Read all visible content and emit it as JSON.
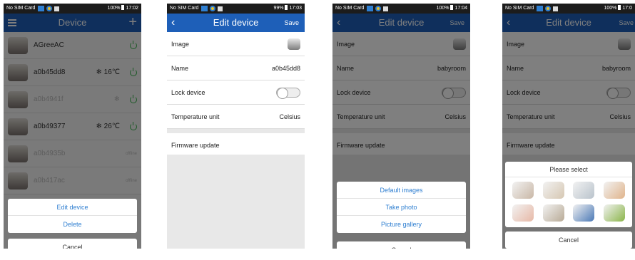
{
  "status_bars": [
    {
      "carrier": "No SIM Card",
      "right": "100%",
      "time": "17:02"
    },
    {
      "carrier": "No SIM Card",
      "right": "99%",
      "time": "17:03"
    },
    {
      "carrier": "No SIM Card",
      "right": "100%",
      "time": "17:04"
    },
    {
      "carrier": "No SIM Card",
      "right": "100%",
      "time": "17:0"
    }
  ],
  "screen1": {
    "title": "Device",
    "devices": [
      {
        "name": "AGreeAC",
        "temp": "",
        "status": ""
      },
      {
        "name": "a0b45dd8",
        "temp": "❄ 16℃",
        "status": ""
      },
      {
        "name": "a0b4941f",
        "temp": "",
        "status": ""
      },
      {
        "name": "a0b49377",
        "temp": "❄ 26℃",
        "status": ""
      },
      {
        "name": "a0b4935b",
        "temp": "",
        "status": "offline"
      },
      {
        "name": "a0b417ac",
        "temp": "",
        "status": "offline"
      }
    ],
    "menu": [
      "Edit device",
      "Delete"
    ],
    "cancel": "Cancel"
  },
  "edit": {
    "back": "‹",
    "title": "Edit device",
    "save": "Save",
    "image_label": "Image",
    "name_label": "Name",
    "lock_label": "Lock device",
    "temp_label": "Temperature unit",
    "temp_value": "Celsius",
    "firmware_label": "Firmware update"
  },
  "screen2": {
    "name_value": "a0b45dd8"
  },
  "screen3": {
    "name_value": "babyroom",
    "options": [
      "Default images",
      "Take photo",
      "Picture gallery"
    ],
    "cancel": "Cancel"
  },
  "screen4": {
    "name_value": "babyroom",
    "temp_value": "Celsius",
    "picker_title": "Please select",
    "cancel": "Cancel",
    "colors": [
      "#c9b7a6",
      "#d6c7b2",
      "#b9c3cc",
      "#e0b48c",
      "#e7b8a6",
      "#b8aa96",
      "#4b79b6",
      "#8bb54a"
    ]
  }
}
